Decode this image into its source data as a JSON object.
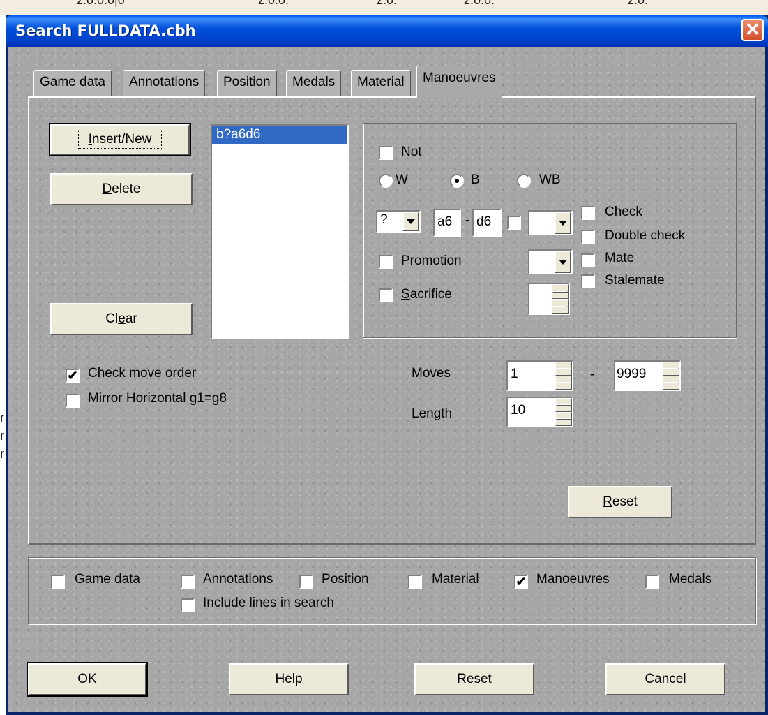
{
  "window": {
    "title": "Search FULLDATA.cbh",
    "close_glyph": "✕"
  },
  "tabs": [
    {
      "label": "Game data",
      "active": false
    },
    {
      "label": "Annotations",
      "active": false
    },
    {
      "label": "Position",
      "active": false
    },
    {
      "label": "Medals",
      "active": false
    },
    {
      "label": "Material",
      "active": false
    },
    {
      "label": "Manoeuvres",
      "active": true
    }
  ],
  "manoeuvres": {
    "insert_label_u": "I",
    "insert_label_rest": "nsert/New",
    "delete_label_u": "D",
    "delete_label_rest": "elete",
    "clear_label_pre": "Cl",
    "clear_label_u": "e",
    "clear_label_rest": "ar",
    "list_items": [
      "b?a6d6"
    ],
    "not_label": "Not",
    "side_w": "W",
    "side_b": "B",
    "side_wb": "WB",
    "side_selected": "B",
    "piece_value": "?",
    "from_square": "a6",
    "dash": "-",
    "to_square": "d6",
    "promotion_label": "Promotion",
    "sacrifice_label_u": "S",
    "sacrifice_label_rest": "acrifice",
    "check_label": "Check",
    "double_check_label": "Double check",
    "mate_label": "Mate",
    "stalemate_label": "Stalemate",
    "check_move_order_label": "Check move order",
    "check_move_order_checked": true,
    "mirror_label": "Mirror Horizontal g1=g8",
    "mirror_checked": false,
    "moves_label_u": "M",
    "moves_label_rest": "oves",
    "moves_from": "1",
    "moves_dash": "-",
    "moves_to": "9999",
    "length_label_pre": "Len",
    "length_label_u": "g",
    "length_label_rest": "th",
    "length_value": "10",
    "reset_label_u": "R",
    "reset_label_rest": "eset"
  },
  "filters": {
    "game_data": "Game data",
    "annotations": "Annotations",
    "position_u": "P",
    "position_rest": "osition",
    "material_pre": "M",
    "material_u": "a",
    "material_rest": "terial",
    "manoeuvres_pre": "M",
    "manoeuvres_u": "a",
    "manoeuvres_rest": "noeuvres",
    "medals_pre": "Me",
    "medals_u": "d",
    "medals_rest": "als",
    "include_lines": "Include lines in search",
    "manoeuvres_checked": true
  },
  "footer": {
    "ok_u": "O",
    "ok_rest": "K",
    "help_u": "H",
    "help_rest": "elp",
    "reset_u": "R",
    "reset_rest": "eset",
    "cancel_u": "C",
    "cancel_rest": "ancel"
  },
  "check_glyph": "✔",
  "background_strip": [
    "z.o.o.o|o",
    "z.o.o.",
    "z.o.",
    "z.o.o.",
    "z.o."
  ],
  "left_marks": [
    "r",
    "r",
    "r"
  ]
}
